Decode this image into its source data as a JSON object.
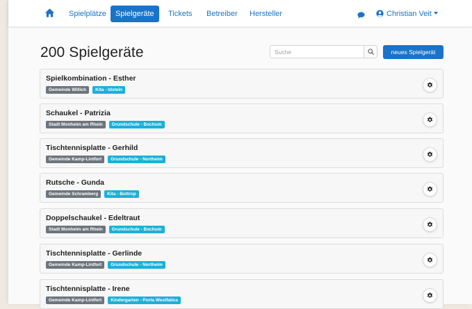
{
  "nav": {
    "items": [
      {
        "label": "Spielplätze",
        "active": false
      },
      {
        "label": "Spielgeräte",
        "active": true
      },
      {
        "label": "Tickets",
        "active": false
      },
      {
        "label": "Betreiber",
        "active": false
      },
      {
        "label": "Hersteller",
        "active": false
      }
    ],
    "user_name": "Christian Veit"
  },
  "header": {
    "title": "200 Spielgeräte",
    "search_placeholder": "Suche",
    "new_button_label": "neues Spielgerät"
  },
  "colors": {
    "primary": "#1a73c8",
    "badge_gray": "#6c757d",
    "badge_blue": "#1bb0d8"
  },
  "devices": [
    {
      "title": "Spielkombination - Esther",
      "operator": "Gemeinde Willich",
      "location": "Kita - Idstein"
    },
    {
      "title": "Schaukel - Patrizia",
      "operator": "Stadt Monheim am Rhein",
      "location": "Grundschule - Bochum"
    },
    {
      "title": "Tischtennisplatte - Gerhild",
      "operator": "Gemeinde Kamp-Lintfort",
      "location": "Grundschule - Northeim"
    },
    {
      "title": "Rutsche - Gunda",
      "operator": "Gemeinde Schramberg",
      "location": "Kita - Bottrop"
    },
    {
      "title": "Doppelschaukel - Edeltraut",
      "operator": "Stadt Monheim am Rhein",
      "location": "Grundschule - Bochum"
    },
    {
      "title": "Tischtennisplatte - Gerlinde",
      "operator": "Gemeinde Kamp-Lintfort",
      "location": "Grundschule - Northeim"
    },
    {
      "title": "Tischtennisplatte - Irene",
      "operator": "Gemeinde Kamp-Lintfort",
      "location": "Kindergarten - Porta Westfalica"
    }
  ]
}
